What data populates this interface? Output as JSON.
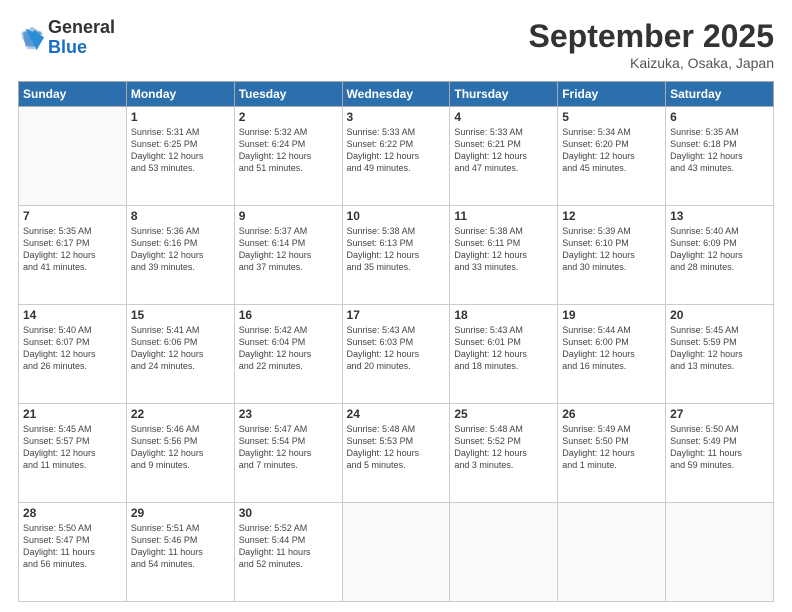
{
  "logo": {
    "general": "General",
    "blue": "Blue"
  },
  "title": "September 2025",
  "subtitle": "Kaizuka, Osaka, Japan",
  "days_of_week": [
    "Sunday",
    "Monday",
    "Tuesday",
    "Wednesday",
    "Thursday",
    "Friday",
    "Saturday"
  ],
  "weeks": [
    [
      {
        "day": "",
        "info": ""
      },
      {
        "day": "1",
        "info": "Sunrise: 5:31 AM\nSunset: 6:25 PM\nDaylight: 12 hours\nand 53 minutes."
      },
      {
        "day": "2",
        "info": "Sunrise: 5:32 AM\nSunset: 6:24 PM\nDaylight: 12 hours\nand 51 minutes."
      },
      {
        "day": "3",
        "info": "Sunrise: 5:33 AM\nSunset: 6:22 PM\nDaylight: 12 hours\nand 49 minutes."
      },
      {
        "day": "4",
        "info": "Sunrise: 5:33 AM\nSunset: 6:21 PM\nDaylight: 12 hours\nand 47 minutes."
      },
      {
        "day": "5",
        "info": "Sunrise: 5:34 AM\nSunset: 6:20 PM\nDaylight: 12 hours\nand 45 minutes."
      },
      {
        "day": "6",
        "info": "Sunrise: 5:35 AM\nSunset: 6:18 PM\nDaylight: 12 hours\nand 43 minutes."
      }
    ],
    [
      {
        "day": "7",
        "info": "Sunrise: 5:35 AM\nSunset: 6:17 PM\nDaylight: 12 hours\nand 41 minutes."
      },
      {
        "day": "8",
        "info": "Sunrise: 5:36 AM\nSunset: 6:16 PM\nDaylight: 12 hours\nand 39 minutes."
      },
      {
        "day": "9",
        "info": "Sunrise: 5:37 AM\nSunset: 6:14 PM\nDaylight: 12 hours\nand 37 minutes."
      },
      {
        "day": "10",
        "info": "Sunrise: 5:38 AM\nSunset: 6:13 PM\nDaylight: 12 hours\nand 35 minutes."
      },
      {
        "day": "11",
        "info": "Sunrise: 5:38 AM\nSunset: 6:11 PM\nDaylight: 12 hours\nand 33 minutes."
      },
      {
        "day": "12",
        "info": "Sunrise: 5:39 AM\nSunset: 6:10 PM\nDaylight: 12 hours\nand 30 minutes."
      },
      {
        "day": "13",
        "info": "Sunrise: 5:40 AM\nSunset: 6:09 PM\nDaylight: 12 hours\nand 28 minutes."
      }
    ],
    [
      {
        "day": "14",
        "info": "Sunrise: 5:40 AM\nSunset: 6:07 PM\nDaylight: 12 hours\nand 26 minutes."
      },
      {
        "day": "15",
        "info": "Sunrise: 5:41 AM\nSunset: 6:06 PM\nDaylight: 12 hours\nand 24 minutes."
      },
      {
        "day": "16",
        "info": "Sunrise: 5:42 AM\nSunset: 6:04 PM\nDaylight: 12 hours\nand 22 minutes."
      },
      {
        "day": "17",
        "info": "Sunrise: 5:43 AM\nSunset: 6:03 PM\nDaylight: 12 hours\nand 20 minutes."
      },
      {
        "day": "18",
        "info": "Sunrise: 5:43 AM\nSunset: 6:01 PM\nDaylight: 12 hours\nand 18 minutes."
      },
      {
        "day": "19",
        "info": "Sunrise: 5:44 AM\nSunset: 6:00 PM\nDaylight: 12 hours\nand 16 minutes."
      },
      {
        "day": "20",
        "info": "Sunrise: 5:45 AM\nSunset: 5:59 PM\nDaylight: 12 hours\nand 13 minutes."
      }
    ],
    [
      {
        "day": "21",
        "info": "Sunrise: 5:45 AM\nSunset: 5:57 PM\nDaylight: 12 hours\nand 11 minutes."
      },
      {
        "day": "22",
        "info": "Sunrise: 5:46 AM\nSunset: 5:56 PM\nDaylight: 12 hours\nand 9 minutes."
      },
      {
        "day": "23",
        "info": "Sunrise: 5:47 AM\nSunset: 5:54 PM\nDaylight: 12 hours\nand 7 minutes."
      },
      {
        "day": "24",
        "info": "Sunrise: 5:48 AM\nSunset: 5:53 PM\nDaylight: 12 hours\nand 5 minutes."
      },
      {
        "day": "25",
        "info": "Sunrise: 5:48 AM\nSunset: 5:52 PM\nDaylight: 12 hours\nand 3 minutes."
      },
      {
        "day": "26",
        "info": "Sunrise: 5:49 AM\nSunset: 5:50 PM\nDaylight: 12 hours\nand 1 minute."
      },
      {
        "day": "27",
        "info": "Sunrise: 5:50 AM\nSunset: 5:49 PM\nDaylight: 11 hours\nand 59 minutes."
      }
    ],
    [
      {
        "day": "28",
        "info": "Sunrise: 5:50 AM\nSunset: 5:47 PM\nDaylight: 11 hours\nand 56 minutes."
      },
      {
        "day": "29",
        "info": "Sunrise: 5:51 AM\nSunset: 5:46 PM\nDaylight: 11 hours\nand 54 minutes."
      },
      {
        "day": "30",
        "info": "Sunrise: 5:52 AM\nSunset: 5:44 PM\nDaylight: 11 hours\nand 52 minutes."
      },
      {
        "day": "",
        "info": ""
      },
      {
        "day": "",
        "info": ""
      },
      {
        "day": "",
        "info": ""
      },
      {
        "day": "",
        "info": ""
      }
    ]
  ]
}
